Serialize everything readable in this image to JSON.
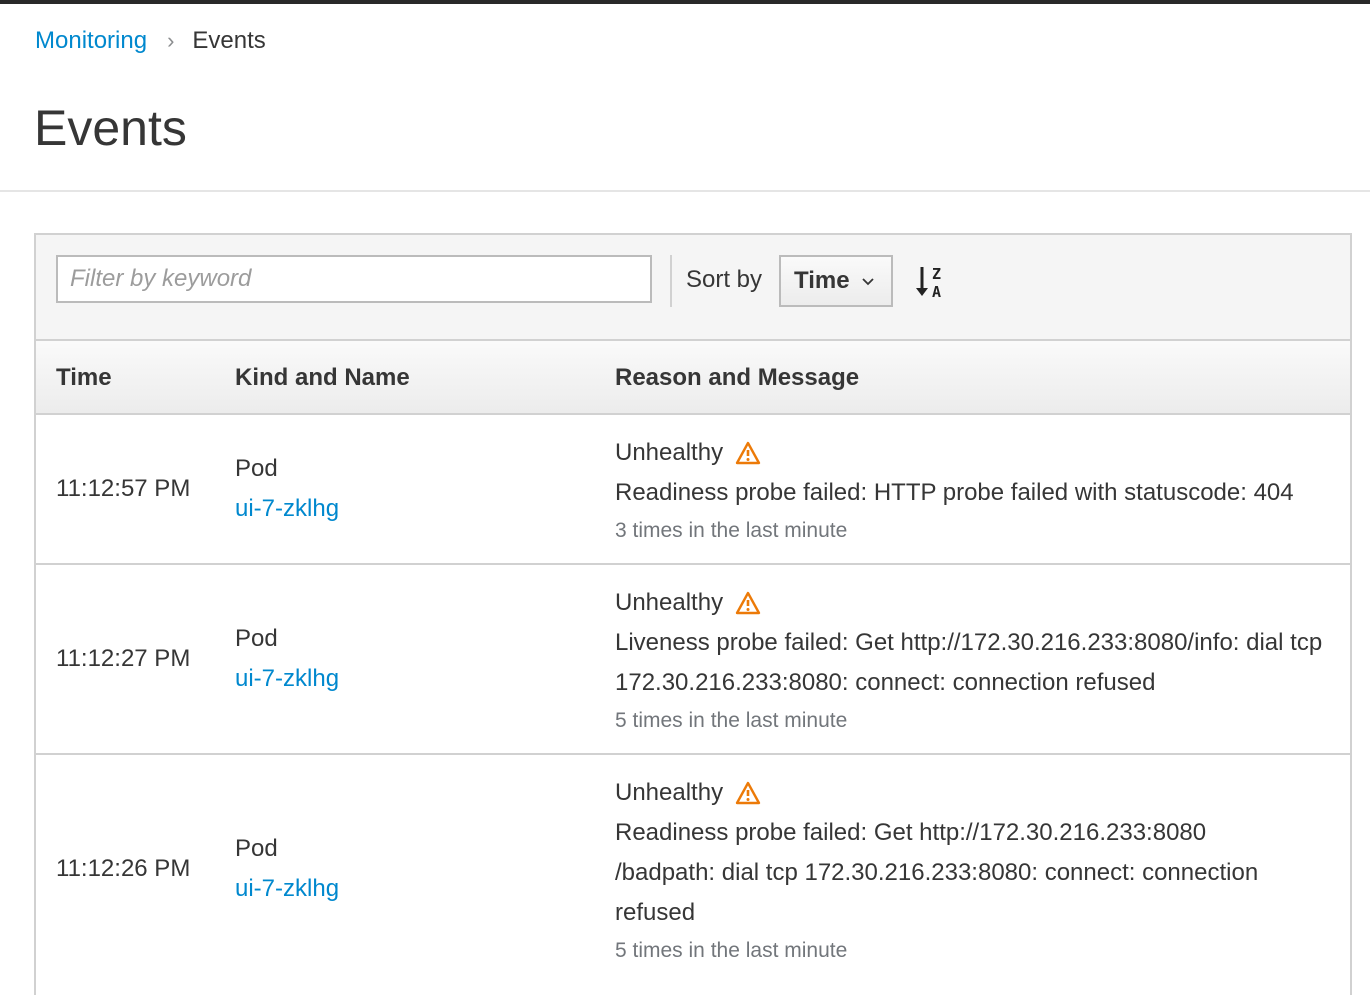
{
  "breadcrumb": {
    "parent": "Monitoring",
    "current": "Events"
  },
  "page": {
    "title": "Events"
  },
  "toolbar": {
    "filter_placeholder": "Filter by keyword",
    "sort_label": "Sort by",
    "sort_value": "Time",
    "sort_direction_icon": "sort-alpha-desc-icon"
  },
  "table": {
    "headers": {
      "time": "Time",
      "kind_name": "Kind and Name",
      "reason_message": "Reason and Message"
    },
    "rows": [
      {
        "time": "11:12:57 PM",
        "kind": "Pod",
        "name": "ui-7-zklhg",
        "reason": "Unhealthy",
        "message": "Readiness probe failed: HTTP probe failed with statuscode: 404",
        "count": "3 times in the last minute"
      },
      {
        "time": "11:12:27 PM",
        "kind": "Pod",
        "name": "ui-7-zklhg",
        "reason": "Unhealthy",
        "message": "Liveness probe failed: Get http://172.30.216.233:8080/info: dial tcp 172.30.216.233:8080: connect: connection refused",
        "count": "5 times in the last minute"
      },
      {
        "time": "11:12:26 PM",
        "kind": "Pod",
        "name": "ui-7-zklhg",
        "reason": "Unhealthy",
        "message": "Readiness probe failed: Get http://172.30.216.233:8080 /badpath: dial tcp 172.30.216.233:8080: connect: connection refused",
        "count": "5 times in the last minute"
      }
    ]
  },
  "colors": {
    "link": "#0088ce",
    "warning": "#ec7a08",
    "muted": "#72767b"
  }
}
